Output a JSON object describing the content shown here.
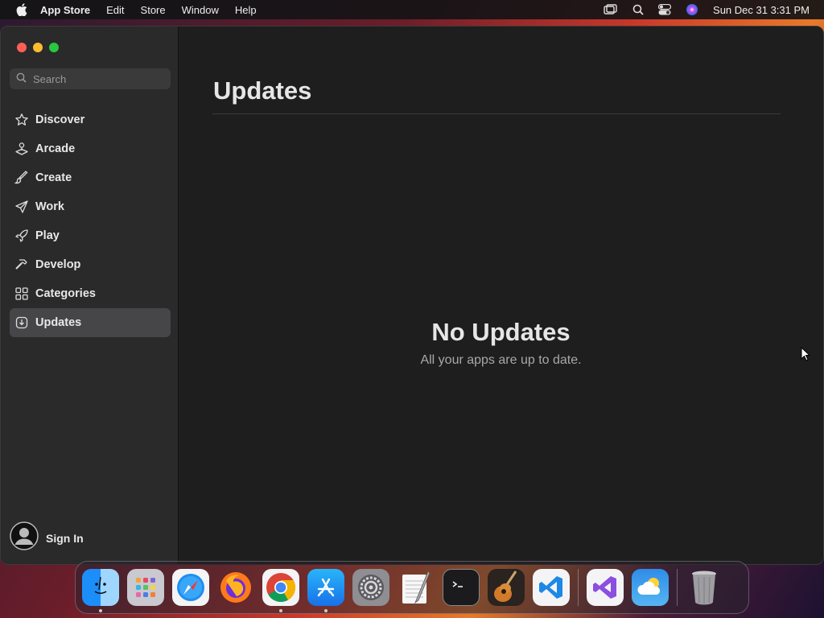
{
  "menubar": {
    "app_name": "App Store",
    "menus": [
      "Edit",
      "Store",
      "Window",
      "Help"
    ],
    "datetime": "Sun Dec 31  3:31 PM"
  },
  "sidebar": {
    "search_placeholder": "Search",
    "items": [
      {
        "label": "Discover",
        "icon": "star-icon"
      },
      {
        "label": "Arcade",
        "icon": "joystick-icon"
      },
      {
        "label": "Create",
        "icon": "brush-icon"
      },
      {
        "label": "Work",
        "icon": "paper-plane-icon"
      },
      {
        "label": "Play",
        "icon": "rocket-icon"
      },
      {
        "label": "Develop",
        "icon": "hammer-icon"
      },
      {
        "label": "Categories",
        "icon": "grid-icon"
      },
      {
        "label": "Updates",
        "icon": "download-icon",
        "active": true
      }
    ],
    "sign_in": "Sign In"
  },
  "main": {
    "title": "Updates",
    "empty_title": "No Updates",
    "empty_subtitle": "All your apps are up to date."
  },
  "dock": {
    "apps": [
      "Finder",
      "Launchpad",
      "Safari",
      "Firefox",
      "Chrome",
      "App Store",
      "System Settings",
      "TextEdit",
      "Terminal",
      "GarageBand",
      "VS Code",
      "Visual Studio",
      "Weather",
      "Trash"
    ]
  },
  "colors": {
    "active_item_bg": "#464648",
    "sidebar_bg": "#2a2a2b",
    "main_bg": "#1e1e1e"
  }
}
